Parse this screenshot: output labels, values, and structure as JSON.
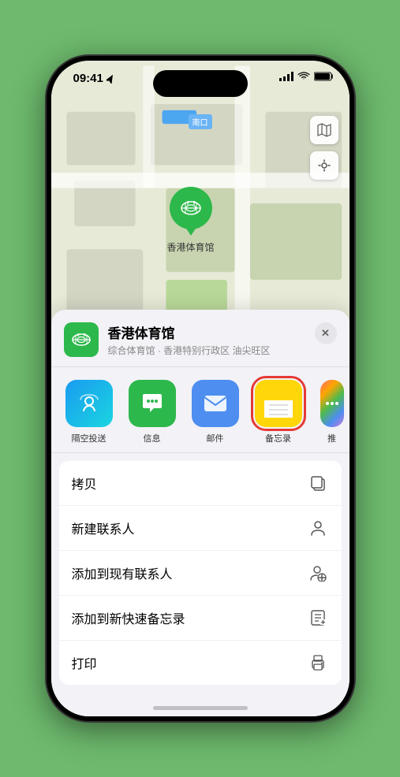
{
  "statusBar": {
    "time": "09:41",
    "locationIcon": "▶",
    "signal": "▐▐▐▐",
    "wifi": "wifi",
    "battery": "🔋"
  },
  "map": {
    "label": "南口",
    "venueName": "香港体育馆"
  },
  "sheet": {
    "venueTitle": "香港体育馆",
    "venueSubtitle": "综合体育馆 · 香港特别行政区 油尖旺区",
    "closeLabel": "×"
  },
  "shareItems": [
    {
      "id": "airdrop",
      "label": "隔空投送",
      "type": "airdrop"
    },
    {
      "id": "messages",
      "label": "信息",
      "type": "messages"
    },
    {
      "id": "mail",
      "label": "邮件",
      "type": "mail"
    },
    {
      "id": "notes",
      "label": "备忘录",
      "type": "notes",
      "selected": true
    },
    {
      "id": "more",
      "label": "推",
      "type": "more"
    }
  ],
  "actionItems": [
    {
      "id": "copy",
      "label": "拷贝",
      "icon": "copy"
    },
    {
      "id": "new-contact",
      "label": "新建联系人",
      "icon": "person"
    },
    {
      "id": "add-contact",
      "label": "添加到现有联系人",
      "icon": "person-add"
    },
    {
      "id": "quick-note",
      "label": "添加到新快速备忘录",
      "icon": "note"
    },
    {
      "id": "print",
      "label": "打印",
      "icon": "print"
    }
  ]
}
